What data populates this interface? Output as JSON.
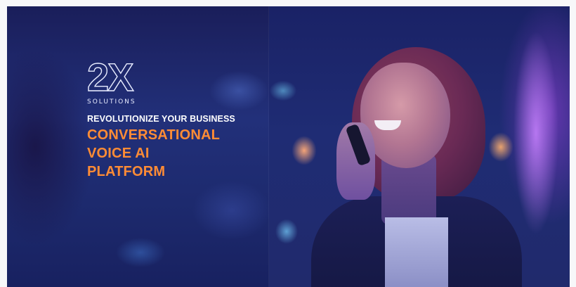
{
  "brand": {
    "logo_mark": "2X",
    "logo_sub": "SOLUTIONS"
  },
  "hero": {
    "eyebrow": "REVOLUTIONIZE YOUR BUSINESS",
    "headline_lines": [
      "CONVERSATIONAL",
      "VOICE AI",
      "PLATFORM"
    ]
  },
  "colors": {
    "accent": "#ff8c35",
    "background_navy": "#1d2a6e",
    "text_light": "#ffffff"
  },
  "icons": {
    "photo": "woman-on-phone-photo"
  }
}
